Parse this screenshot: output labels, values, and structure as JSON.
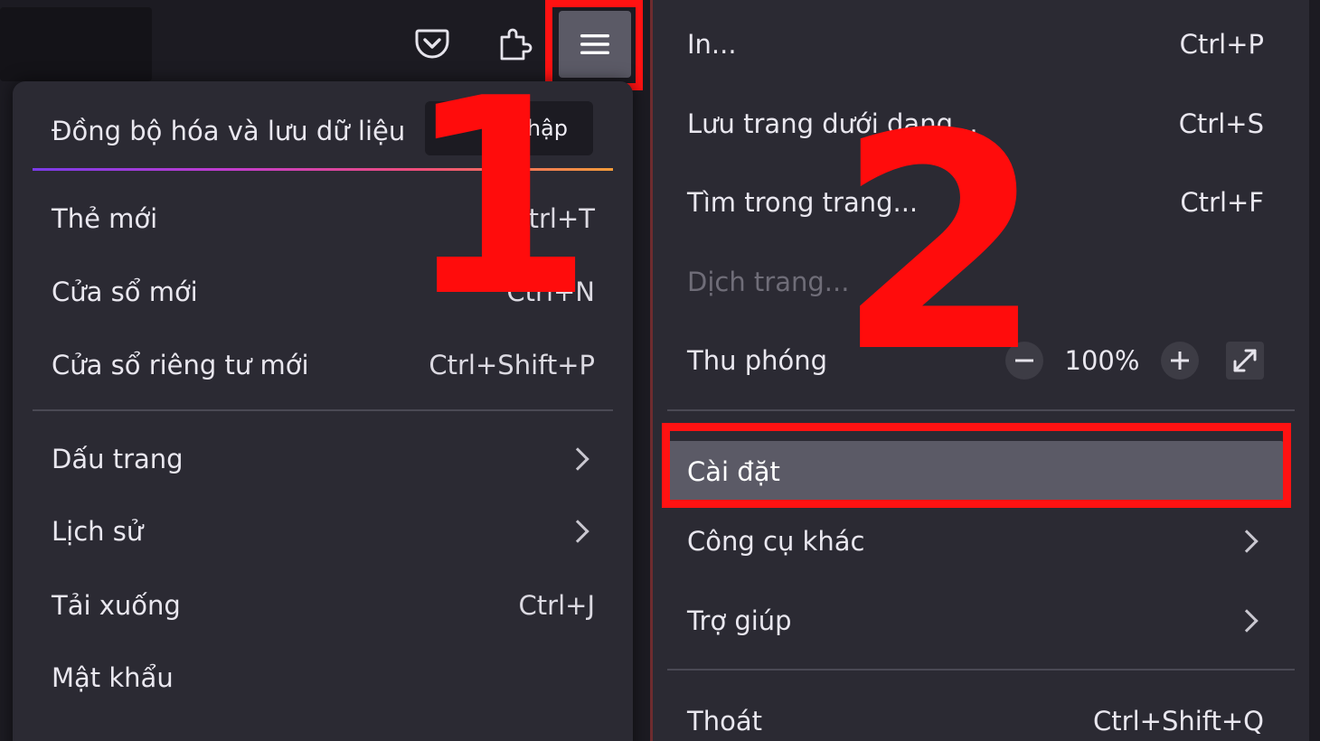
{
  "left_menu": {
    "sync": {
      "label": "Đồng bộ hóa và lưu dữ liệu",
      "signin_label": "g nhập"
    },
    "items_top": [
      {
        "label": "Thẻ mới",
        "shortcut": "Ctrl+T"
      },
      {
        "label": "Cửa sổ mới",
        "shortcut": "Ctrl+N"
      },
      {
        "label": "Cửa sổ riêng tư mới",
        "shortcut": "Ctrl+Shift+P"
      }
    ],
    "items_bottom": [
      {
        "label": "Dấu trang"
      },
      {
        "label": "Lịch sử"
      },
      {
        "label": "Tải xuống",
        "shortcut": "Ctrl+J"
      },
      {
        "label": "Mật khẩu"
      }
    ]
  },
  "right_menu": {
    "items_top": [
      {
        "label": "In...",
        "shortcut": "Ctrl+P"
      },
      {
        "label": "Lưu trang dưới dạng...",
        "shortcut": "Ctrl+S"
      },
      {
        "label": "Tìm trong trang...",
        "shortcut": "Ctrl+F"
      },
      {
        "label": "Dịch trang..."
      }
    ],
    "zoom": {
      "label": "Thu phóng",
      "value": "100%"
    },
    "settings": {
      "label": "Cài đặt"
    },
    "more_tools": {
      "label": "Công cụ khác"
    },
    "help": {
      "label": "Trợ giúp"
    },
    "exit": {
      "label": "Thoát",
      "shortcut": "Ctrl+Shift+Q"
    }
  },
  "annotations": {
    "step_1": "1",
    "step_2": "2",
    "highlight_color": "#ff1212"
  },
  "icons": {
    "pocket": "pocket-icon",
    "extensions": "puzzle-icon",
    "menu": "hamburger-menu-icon",
    "zoom_out": "minus-icon",
    "zoom_in": "plus-icon",
    "fullscreen": "fullscreen-icon",
    "submenu": "chevron-right-icon"
  }
}
